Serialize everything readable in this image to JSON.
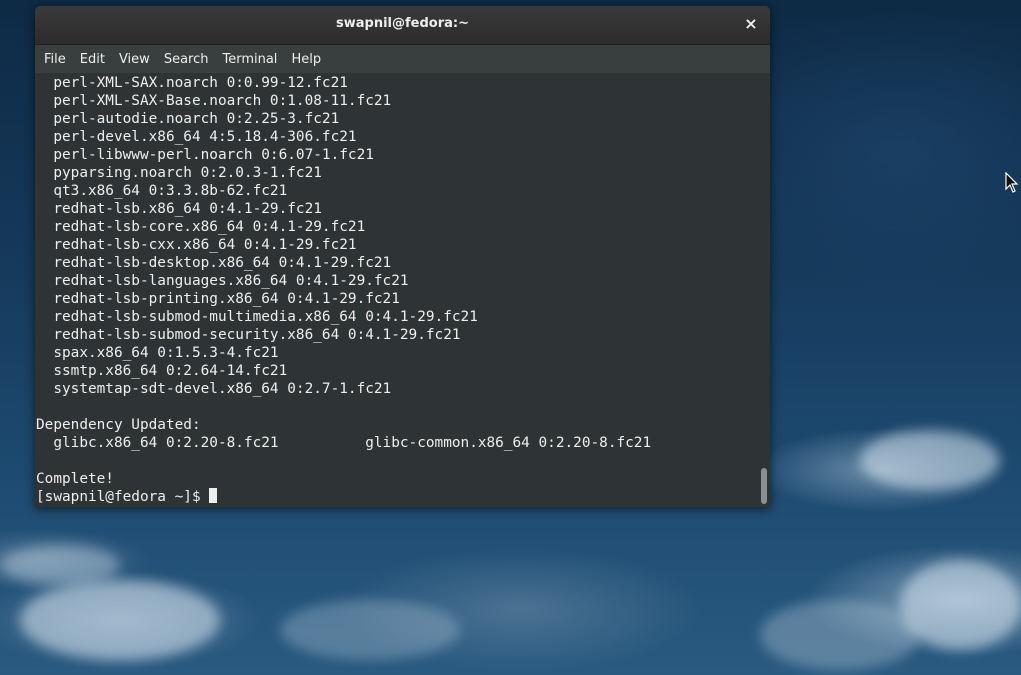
{
  "window": {
    "title": "swapnil@fedora:~",
    "close_glyph": "×"
  },
  "menu": {
    "items": [
      "File",
      "Edit",
      "View",
      "Search",
      "Terminal",
      "Help"
    ]
  },
  "terminal": {
    "lines": [
      "  perl-XML-SAX.noarch 0:0.99-12.fc21",
      "  perl-XML-SAX-Base.noarch 0:1.08-11.fc21",
      "  perl-autodie.noarch 0:2.25-3.fc21",
      "  perl-devel.x86_64 4:5.18.4-306.fc21",
      "  perl-libwww-perl.noarch 0:6.07-1.fc21",
      "  pyparsing.noarch 0:2.0.3-1.fc21",
      "  qt3.x86_64 0:3.3.8b-62.fc21",
      "  redhat-lsb.x86_64 0:4.1-29.fc21",
      "  redhat-lsb-core.x86_64 0:4.1-29.fc21",
      "  redhat-lsb-cxx.x86_64 0:4.1-29.fc21",
      "  redhat-lsb-desktop.x86_64 0:4.1-29.fc21",
      "  redhat-lsb-languages.x86_64 0:4.1-29.fc21",
      "  redhat-lsb-printing.x86_64 0:4.1-29.fc21",
      "  redhat-lsb-submod-multimedia.x86_64 0:4.1-29.fc21",
      "  redhat-lsb-submod-security.x86_64 0:4.1-29.fc21",
      "  spax.x86_64 0:1.5.3-4.fc21",
      "  ssmtp.x86_64 0:2.64-14.fc21",
      "  systemtap-sdt-devel.x86_64 0:2.7-1.fc21",
      "",
      "Dependency Updated:",
      "  glibc.x86_64 0:2.20-8.fc21          glibc-common.x86_64 0:2.20-8.fc21",
      "",
      "Complete!"
    ],
    "prompt": "[swapnil@fedora ~]$ "
  },
  "colors": {
    "terminal_bg": "#2e3436",
    "terminal_fg": "#eeeeec",
    "titlebar_bg": "#2c2c2c",
    "menubar_bg": "#393f3f"
  }
}
